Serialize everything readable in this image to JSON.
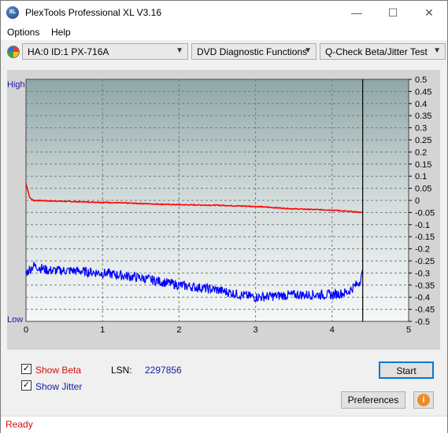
{
  "window": {
    "title": "PlexTools Professional XL V3.16",
    "app_icon_text": "XL"
  },
  "menu": {
    "items": [
      "Options",
      "Help"
    ]
  },
  "toolbar": {
    "drive_select": "HA:0 ID:1  PX-716A",
    "function_select": "DVD Diagnostic Functions",
    "test_select": "Q-Check Beta/Jitter Test"
  },
  "chart": {
    "high_label": "High",
    "low_label": "Low",
    "x_ticks": [
      "0",
      "1",
      "2",
      "3",
      "4",
      "5"
    ],
    "y_ticks": [
      "0.5",
      "0.45",
      "0.4",
      "0.35",
      "0.3",
      "0.25",
      "0.2",
      "0.15",
      "0.1",
      "0.05",
      "0",
      "-0.05",
      "-0.1",
      "-0.15",
      "-0.2",
      "-0.25",
      "-0.3",
      "-0.35",
      "-0.4",
      "-0.45",
      "-0.5"
    ]
  },
  "chart_data": {
    "type": "line",
    "xlim": [
      0,
      5
    ],
    "ylim": [
      -0.5,
      0.5
    ],
    "grid": true,
    "end_marker_x": 4.4,
    "series": [
      {
        "color": "#ff0000",
        "x": [
          0,
          0.05,
          0.1,
          0.3,
          0.6,
          1.0,
          1.5,
          2.0,
          2.5,
          3.0,
          3.5,
          4.0,
          4.4
        ],
        "y": [
          0.07,
          0.01,
          0.0,
          -0.002,
          -0.005,
          -0.008,
          -0.013,
          -0.018,
          -0.02,
          -0.025,
          -0.035,
          -0.04,
          -0.05
        ]
      },
      {
        "color": "#0000ff",
        "x": [
          0,
          0.1,
          0.3,
          0.6,
          1.0,
          1.5,
          2.0,
          2.5,
          2.8,
          3.0,
          3.5,
          4.0,
          4.2,
          4.35,
          4.4
        ],
        "y": [
          -0.3,
          -0.27,
          -0.29,
          -0.29,
          -0.3,
          -0.32,
          -0.35,
          -0.37,
          -0.39,
          -0.4,
          -0.39,
          -0.39,
          -0.38,
          -0.34,
          -0.3
        ]
      }
    ]
  },
  "options": {
    "show_beta_label": "Show Beta",
    "show_beta_checked": true,
    "show_jitter_label": "Show Jitter",
    "show_jitter_checked": true,
    "lsn_label": "LSN:",
    "lsn_value": "2297856"
  },
  "buttons": {
    "start": "Start",
    "preferences": "Preferences"
  },
  "status": {
    "text": "Ready"
  },
  "colors": {
    "beta_label": "#d01010",
    "jitter_label": "#1a1aa0",
    "status_text": "#d01010"
  }
}
